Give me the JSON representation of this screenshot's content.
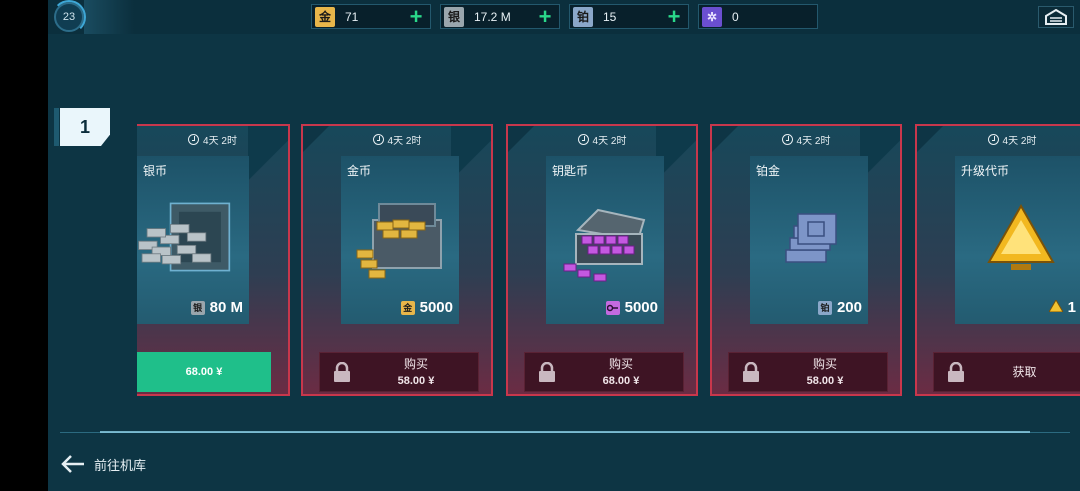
{
  "player": {
    "level": "23"
  },
  "resources": [
    {
      "name": "gold",
      "icon_char": "金",
      "color": "#e8b64a",
      "value": "71",
      "has_plus": true
    },
    {
      "name": "silver",
      "icon_char": "银",
      "color": "#9aa6ad",
      "value": "17.2 M",
      "has_plus": true
    },
    {
      "name": "platinum",
      "icon_char": "铂",
      "color": "#8ba7c9",
      "value": "15",
      "has_plus": true
    },
    {
      "name": "research",
      "icon_char": "✲",
      "color": "#6b4fd0",
      "value": "0",
      "has_plus": false
    }
  ],
  "tier": "1",
  "cards": [
    {
      "timer": "4天 2时",
      "name": "银币",
      "qty_icon": "银",
      "qty_icon_color": "#9aa6ad",
      "qty": "80 M",
      "button_type": "price",
      "button_label": "",
      "button_price": "68.00 ¥"
    },
    {
      "timer": "4天 2时",
      "name": "金币",
      "qty_icon": "金",
      "qty_icon_color": "#e8b64a",
      "qty": "5000",
      "button_type": "locked",
      "button_label": "购买",
      "button_price": "58.00 ¥"
    },
    {
      "timer": "4天 2时",
      "name": "钥匙币",
      "qty_icon": "key",
      "qty_icon_color": "#c46ae0",
      "qty": "5000",
      "button_type": "locked",
      "button_label": "购买",
      "button_price": "68.00 ¥"
    },
    {
      "timer": "4天 2时",
      "name": "铂金",
      "qty_icon": "铂",
      "qty_icon_color": "#8ba7c9",
      "qty": "200",
      "button_type": "locked",
      "button_label": "购买",
      "button_price": "58.00 ¥"
    },
    {
      "timer": "4天 2时",
      "name": "升级代币",
      "qty_icon": "triangle",
      "qty_icon_color": "#f2c230",
      "qty": "1",
      "button_type": "locked-single",
      "button_label": "获取",
      "button_price": ""
    }
  ],
  "footer": {
    "back_label": "前往机库"
  }
}
